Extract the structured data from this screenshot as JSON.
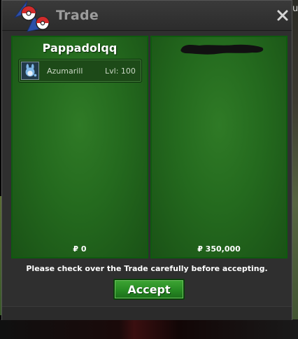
{
  "window": {
    "title": "Trade"
  },
  "background": {
    "edge_text": "u"
  },
  "left_panel": {
    "player_name": "Pappadolqq",
    "items": [
      {
        "name": "Azumarill",
        "level": "Lvl: 100",
        "icon": "azumarill-icon"
      }
    ],
    "money": "₽ 0"
  },
  "right_panel": {
    "player_name_redacted": true,
    "money": "₽ 350,000"
  },
  "notice": "Please check over the Trade carefully before accepting.",
  "accept_button": {
    "label": "Accept"
  },
  "colors": {
    "panel_green": "#246a1e",
    "panel_border": "#0f5a0f",
    "window_bg": "#2f2f2f",
    "title_text": "#9c9c9c",
    "button_green": "#278a23"
  }
}
